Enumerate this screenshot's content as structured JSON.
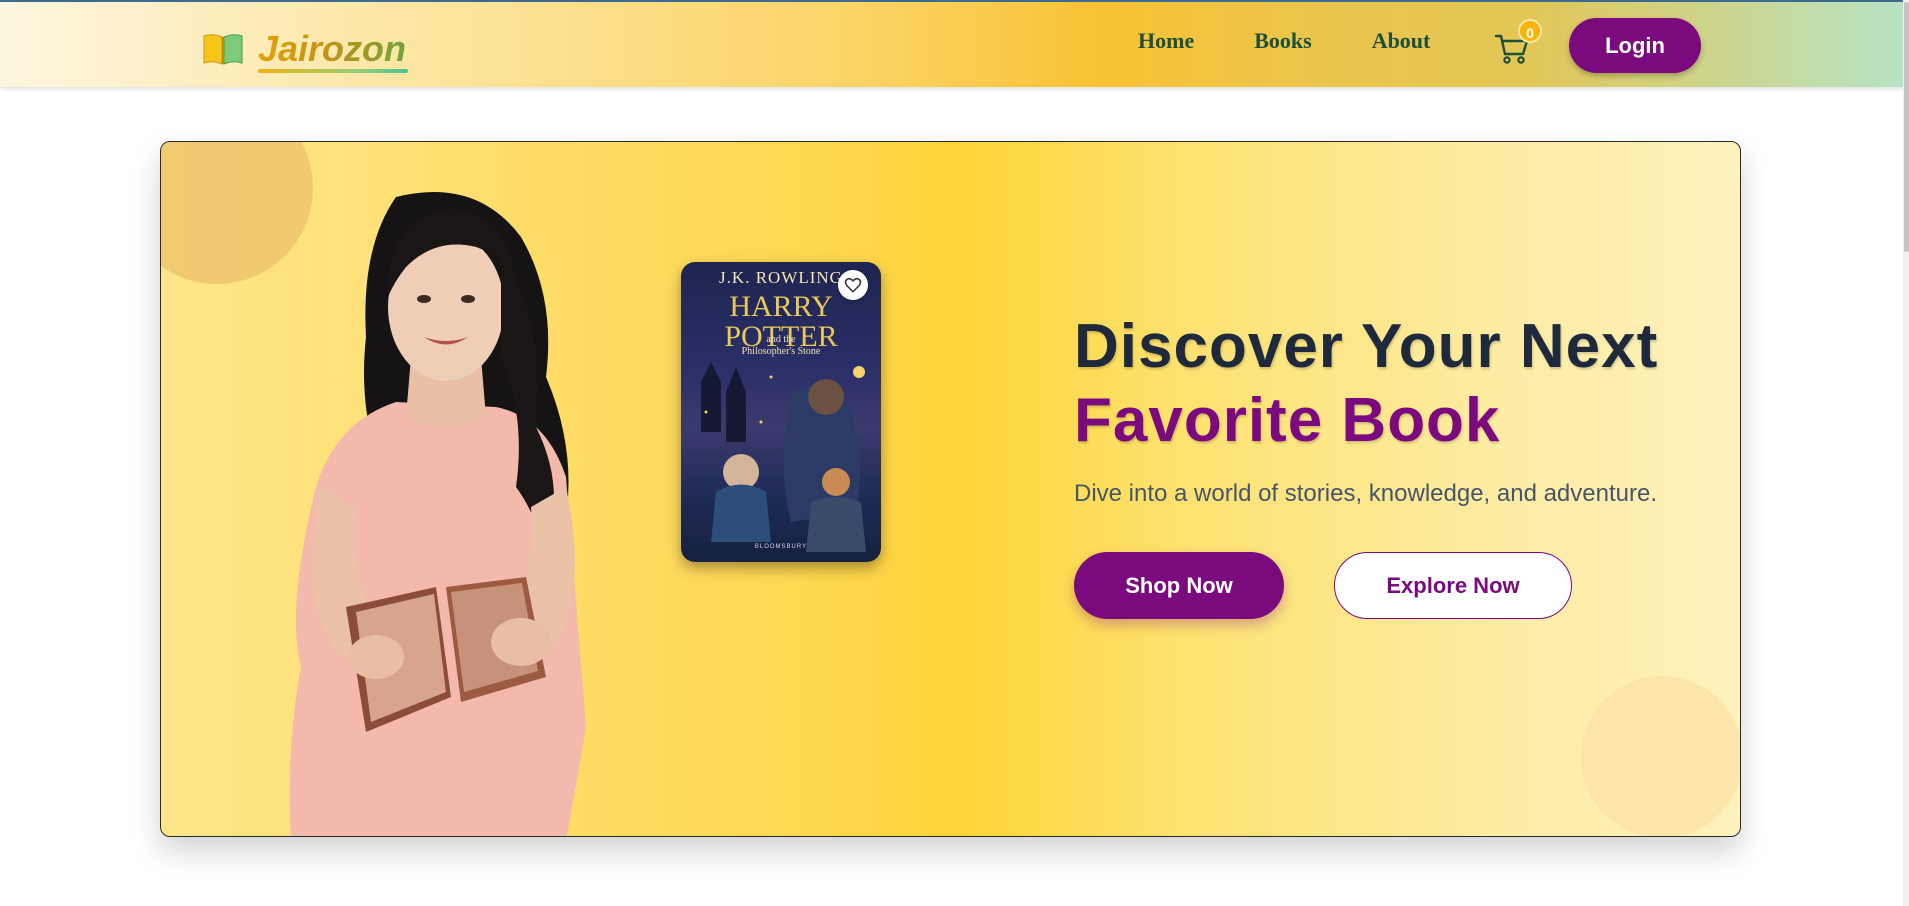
{
  "brand": {
    "name": "Jairozon",
    "icon": "open-book-icon"
  },
  "nav": {
    "links": [
      {
        "label": "Home"
      },
      {
        "label": "Books"
      },
      {
        "label": "About"
      }
    ],
    "cart_count": "0",
    "cart_icon": "cart-icon",
    "login_label": "Login"
  },
  "hero": {
    "headline_line1": "Discover Your Next",
    "headline_line2": "Favorite Book",
    "tagline": "Dive into a world of stories, knowledge, and adventure.",
    "shop_label": "Shop Now",
    "explore_label": "Explore Now",
    "featured_book": {
      "author": "J.K. ROWLING",
      "title": "HARRY POTTER",
      "subtitle_line1": "and the",
      "subtitle_line2": "Philosopher's Stone",
      "publisher": "BLOOMSBURY",
      "favorite_icon": "heart-icon"
    }
  },
  "colors": {
    "accent": "#7b0a7e",
    "headline": "#1e293b",
    "nav_text": "#1e4f38",
    "badge": "#f5b50c"
  }
}
